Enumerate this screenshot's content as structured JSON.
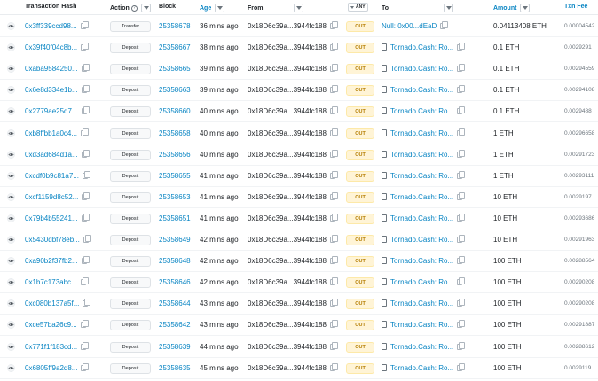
{
  "headers": {
    "eye": "",
    "hash": "Transaction Hash",
    "action": "Action",
    "block": "Block",
    "age": "Age",
    "from": "From",
    "any": "ANY",
    "to": "To",
    "amount": "Amount",
    "fee": "Txn Fee"
  },
  "rows": [
    {
      "hash": "0x3ff339ccd98...",
      "action": "Transfer",
      "block": "25358678",
      "age": "36 mins ago",
      "from": "0x18D6c39a...3944fc188",
      "dir": "OUT",
      "to": "Null: 0x00...dEaD",
      "to_type": "null",
      "amount": "0.04113408 ETH",
      "fee": "0.00004542"
    },
    {
      "hash": "0x39f40f04c8b...",
      "action": "Deposit",
      "block": "25358667",
      "age": "38 mins ago",
      "from": "0x18D6c39a...3944fc188",
      "dir": "OUT",
      "to": "Tornado.Cash: Ro...",
      "to_type": "contract",
      "amount": "0.1 ETH",
      "fee": "0.0029291"
    },
    {
      "hash": "0xaba9584250...",
      "action": "Deposit",
      "block": "25358665",
      "age": "39 mins ago",
      "from": "0x18D6c39a...3944fc188",
      "dir": "OUT",
      "to": "Tornado.Cash: Ro...",
      "to_type": "contract",
      "amount": "0.1 ETH",
      "fee": "0.00294559"
    },
    {
      "hash": "0x6e8d334e1b...",
      "action": "Deposit",
      "block": "25358663",
      "age": "39 mins ago",
      "from": "0x18D6c39a...3944fc188",
      "dir": "OUT",
      "to": "Tornado.Cash: Ro...",
      "to_type": "contract",
      "amount": "0.1 ETH",
      "fee": "0.00294108"
    },
    {
      "hash": "0x2779ae25d7...",
      "action": "Deposit",
      "block": "25358660",
      "age": "40 mins ago",
      "from": "0x18D6c39a...3944fc188",
      "dir": "OUT",
      "to": "Tornado.Cash: Ro...",
      "to_type": "contract",
      "amount": "0.1 ETH",
      "fee": "0.0029488"
    },
    {
      "hash": "0xb8ffbb1a0c4...",
      "action": "Deposit",
      "block": "25358658",
      "age": "40 mins ago",
      "from": "0x18D6c39a...3944fc188",
      "dir": "OUT",
      "to": "Tornado.Cash: Ro...",
      "to_type": "contract",
      "amount": "1 ETH",
      "fee": "0.00296658"
    },
    {
      "hash": "0xd3ad684d1a...",
      "action": "Deposit",
      "block": "25358656",
      "age": "40 mins ago",
      "from": "0x18D6c39a...3944fc188",
      "dir": "OUT",
      "to": "Tornado.Cash: Ro...",
      "to_type": "contract",
      "amount": "1 ETH",
      "fee": "0.00291723"
    },
    {
      "hash": "0xcdf0b9c81a7...",
      "action": "Deposit",
      "block": "25358655",
      "age": "41 mins ago",
      "from": "0x18D6c39a...3944fc188",
      "dir": "OUT",
      "to": "Tornado.Cash: Ro...",
      "to_type": "contract",
      "amount": "1 ETH",
      "fee": "0.00293111"
    },
    {
      "hash": "0xcf1159d8c52...",
      "action": "Deposit",
      "block": "25358653",
      "age": "41 mins ago",
      "from": "0x18D6c39a...3944fc188",
      "dir": "OUT",
      "to": "Tornado.Cash: Ro...",
      "to_type": "contract",
      "amount": "10 ETH",
      "fee": "0.0029197"
    },
    {
      "hash": "0x79b4b55241...",
      "action": "Deposit",
      "block": "25358651",
      "age": "41 mins ago",
      "from": "0x18D6c39a...3944fc188",
      "dir": "OUT",
      "to": "Tornado.Cash: Ro...",
      "to_type": "contract",
      "amount": "10 ETH",
      "fee": "0.00293686"
    },
    {
      "hash": "0x5430dbf78eb...",
      "action": "Deposit",
      "block": "25358649",
      "age": "42 mins ago",
      "from": "0x18D6c39a...3944fc188",
      "dir": "OUT",
      "to": "Tornado.Cash: Ro...",
      "to_type": "contract",
      "amount": "10 ETH",
      "fee": "0.00291963"
    },
    {
      "hash": "0xa90b2f37fb2...",
      "action": "Deposit",
      "block": "25358648",
      "age": "42 mins ago",
      "from": "0x18D6c39a...3944fc188",
      "dir": "OUT",
      "to": "Tornado.Cash: Ro...",
      "to_type": "contract",
      "amount": "100 ETH",
      "fee": "0.00288564"
    },
    {
      "hash": "0x1b7c173abc...",
      "action": "Deposit",
      "block": "25358646",
      "age": "42 mins ago",
      "from": "0x18D6c39a...3944fc188",
      "dir": "OUT",
      "to": "Tornado.Cash: Ro...",
      "to_type": "contract",
      "amount": "100 ETH",
      "fee": "0.00290208"
    },
    {
      "hash": "0xc080b137a5f...",
      "action": "Deposit",
      "block": "25358644",
      "age": "43 mins ago",
      "from": "0x18D6c39a...3944fc188",
      "dir": "OUT",
      "to": "Tornado.Cash: Ro...",
      "to_type": "contract",
      "amount": "100 ETH",
      "fee": "0.00290208"
    },
    {
      "hash": "0xce57ba26c9...",
      "action": "Deposit",
      "block": "25358642",
      "age": "43 mins ago",
      "from": "0x18D6c39a...3944fc188",
      "dir": "OUT",
      "to": "Tornado.Cash: Ro...",
      "to_type": "contract",
      "amount": "100 ETH",
      "fee": "0.00291887"
    },
    {
      "hash": "0x771f1f183cd...",
      "action": "Deposit",
      "block": "25358639",
      "age": "44 mins ago",
      "from": "0x18D6c39a...3944fc188",
      "dir": "OUT",
      "to": "Tornado.Cash: Ro...",
      "to_type": "contract",
      "amount": "100 ETH",
      "fee": "0.00288612"
    },
    {
      "hash": "0x6805ff9a2d8...",
      "action": "Deposit",
      "block": "25358635",
      "age": "45 mins ago",
      "from": "0x18D6c39a...3944fc188",
      "dir": "OUT",
      "to": "Tornado.Cash: Ro...",
      "to_type": "contract",
      "amount": "100 ETH",
      "fee": "0.0029119"
    }
  ],
  "colors": {
    "link": "#0784c3",
    "out_badge_bg": "#fff4d6",
    "out_badge_text": "#b47d00"
  },
  "icons": {
    "view": "eye-icon",
    "copy": "copy-icon",
    "filter": "filter-icon",
    "contract": "contract-icon",
    "help": "question-icon"
  }
}
